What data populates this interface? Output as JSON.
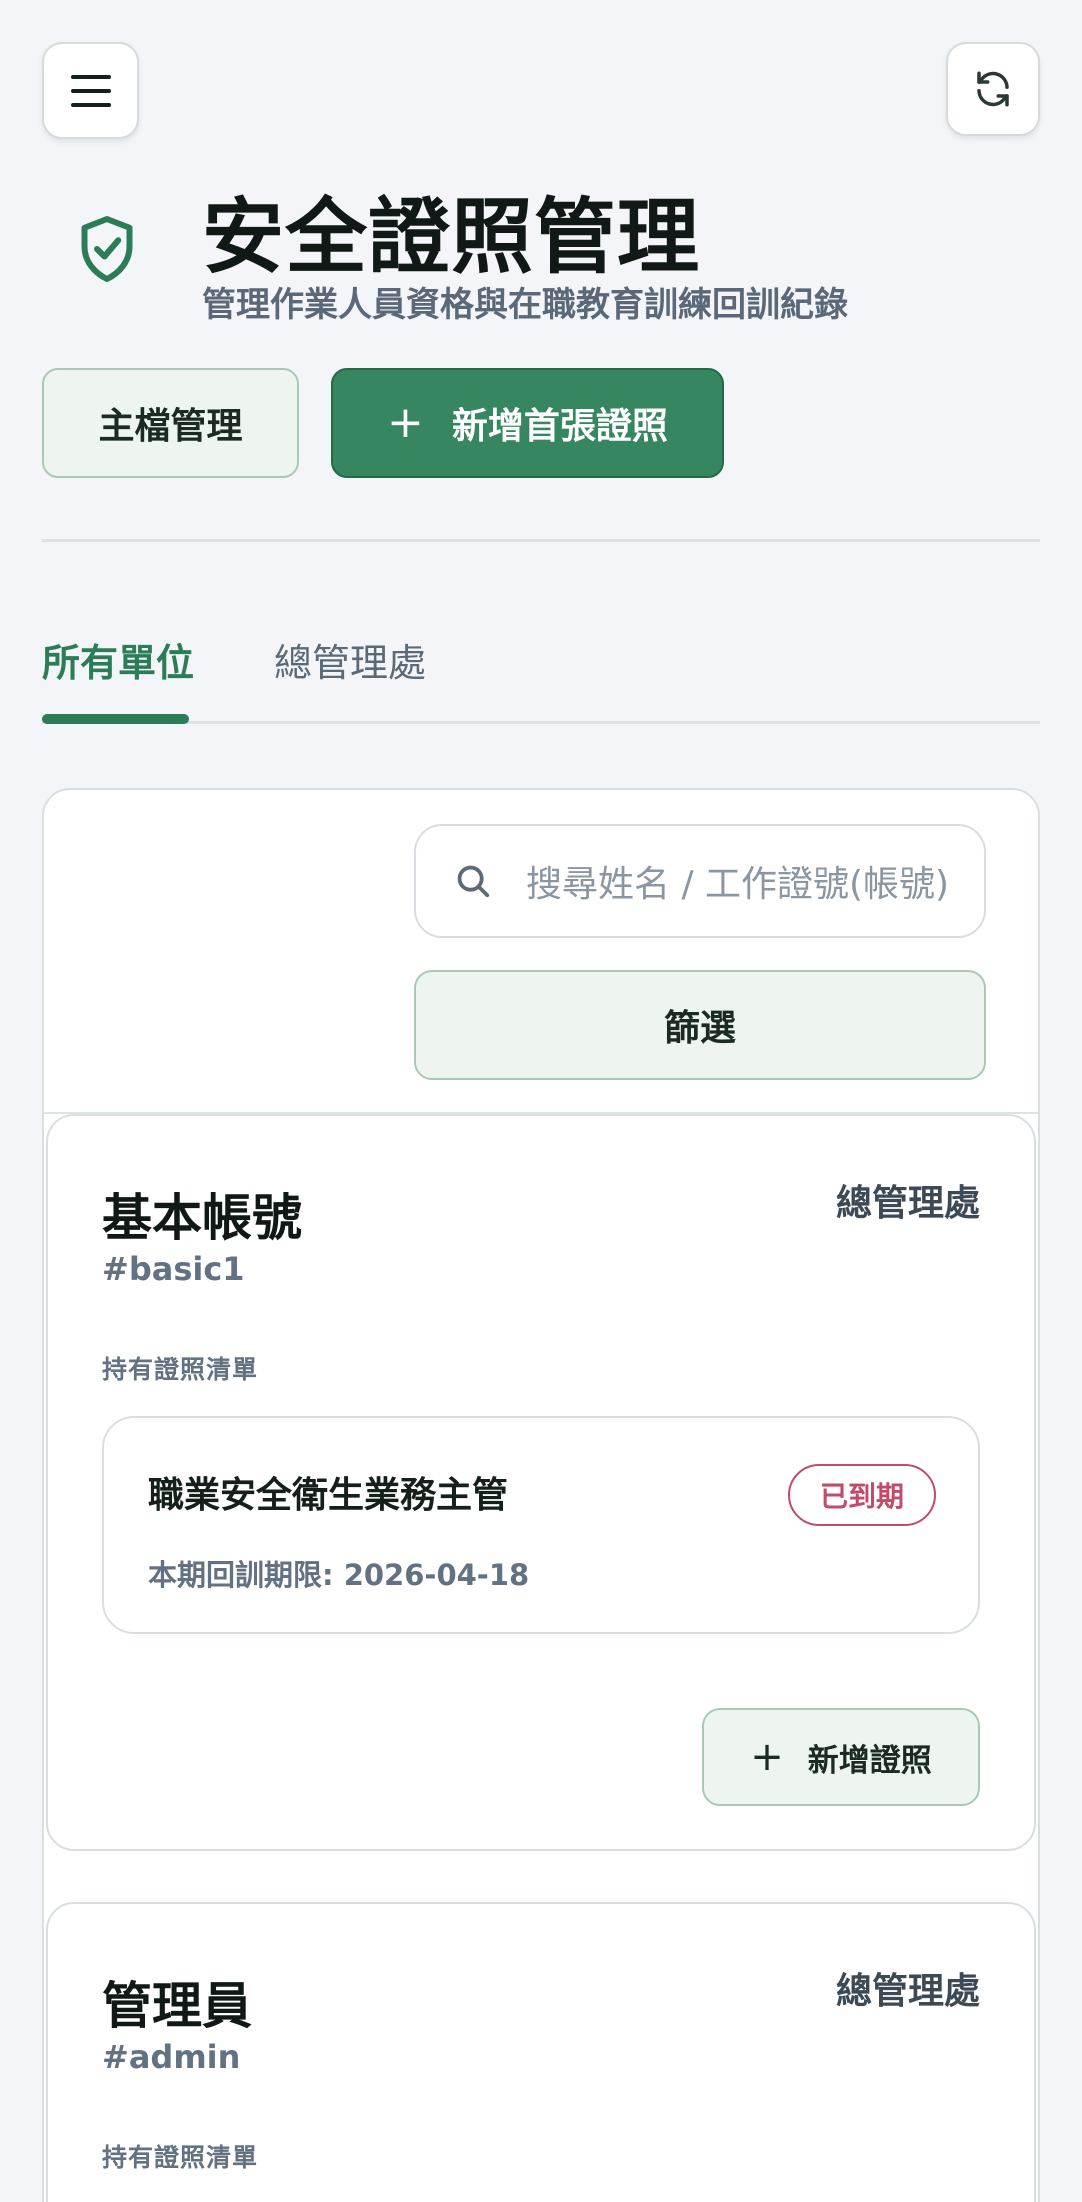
{
  "header": {
    "title": "安全證照管理",
    "subtitle": "管理作業人員資格與在職教育訓練回訓紀錄"
  },
  "actions": {
    "master_label": "主檔管理",
    "add_first_label": "新增首張證照",
    "add_first_icon": "plus-icon"
  },
  "tabs": [
    {
      "label": "所有單位",
      "active": true
    },
    {
      "label": "總管理處",
      "active": false
    }
  ],
  "search": {
    "placeholder": "搜尋姓名 / 工作證號(帳號)"
  },
  "filter": {
    "label": "篩選"
  },
  "users": [
    {
      "name": "基本帳號",
      "id": "#basic1",
      "unit": "總管理處",
      "cert_list_label": "持有證照清單",
      "certs": [
        {
          "name": "職業安全衛生業務主管",
          "status": "已到期",
          "deadline": "本期回訓期限: 2026-04-18"
        }
      ],
      "add_cert_label": "新增證照"
    },
    {
      "name": "管理員",
      "id": "#admin",
      "unit": "總管理處",
      "cert_list_label": "持有證照清單"
    }
  ],
  "colors": {
    "accent": "#2b7d58",
    "primary_button": "#36875f",
    "expired": "#c24a6a",
    "background": "#f3f5f8"
  }
}
